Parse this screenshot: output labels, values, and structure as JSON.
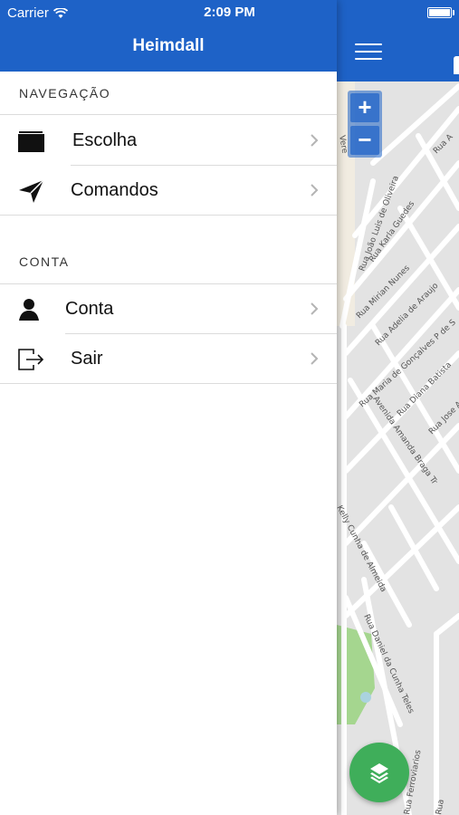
{
  "status_bar": {
    "carrier": "Carrier",
    "time": "2:09 PM"
  },
  "drawer": {
    "title": "Heimdall",
    "sections": [
      {
        "label": "NAVEGAÇÃO",
        "items": [
          {
            "label": "Escolha",
            "icon": "folder-icon"
          },
          {
            "label": "Comandos",
            "icon": "paper-plane-icon"
          }
        ]
      },
      {
        "label": "CONTA",
        "items": [
          {
            "label": "Conta",
            "icon": "user-icon"
          },
          {
            "label": "Sair",
            "icon": "logout-icon"
          }
        ]
      }
    ]
  },
  "map": {
    "zoom_in": "+",
    "zoom_out": "−",
    "streets": [
      "Rua João Luis de Oliveira",
      "Rua Karla Guedes",
      "Rua Mirian Nunes",
      "Rua Adelia de Araujo",
      "Rua Maria de Gonçalves P de S",
      "Rua Diana Batista",
      "Rua Jose Au",
      "Avenida Amanda Braga Tr",
      "Kelly Cunha de Almeida",
      "Rua Daniel da Cunha Teles",
      "Rua Ferroviarios",
      "Rua A",
      "Rua",
      "Vere"
    ]
  },
  "colors": {
    "brand_blue": "#1e62c7",
    "fab_green": "#3fae5a",
    "map_bg": "#e7e7e7",
    "park_green": "#a5d68f"
  }
}
